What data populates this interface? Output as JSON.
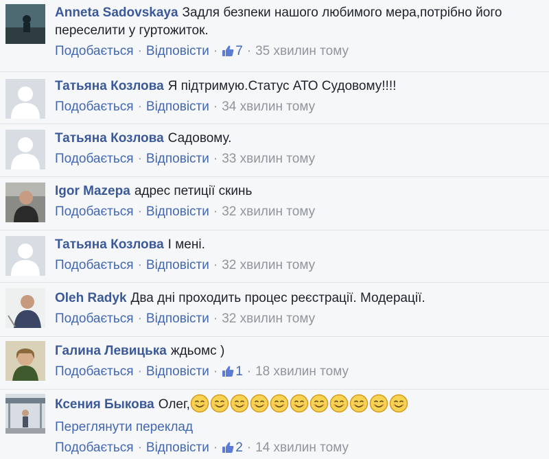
{
  "labels": {
    "like": "Подобається",
    "reply": "Відповісти",
    "dot": "·",
    "translate": "Переглянути переклад"
  },
  "colors": {
    "name": "#3b5998",
    "link": "#4267b2",
    "meta": "#90949c",
    "border": "#e1e2e6",
    "background": "#f6f7f9"
  },
  "comments": [
    {
      "name": "Anneta Sadovskaya",
      "text": "Задля безпеки нашого любимого мера,потрібно його переселити у гуртожиток.",
      "likes": "7",
      "time": "35 хвилин тому",
      "avatar": "photo"
    },
    {
      "name": "Татьяна Козлова",
      "text": "Я підтримую.Статус АТО Судовому!!!!",
      "likes": null,
      "time": "34 хвилин тому",
      "avatar": "silhouette"
    },
    {
      "name": "Татьяна Козлова",
      "text": "Садовому.",
      "likes": null,
      "time": "33 хвилин тому",
      "avatar": "silhouette"
    },
    {
      "name": "Igor Mazepa",
      "text": "адрес петиції скинь",
      "likes": null,
      "time": "32 хвилин тому",
      "avatar": "photo"
    },
    {
      "name": "Татьяна Козлова",
      "text": "І мені.",
      "likes": null,
      "time": "32 хвилин тому",
      "avatar": "silhouette"
    },
    {
      "name": "Oleh Radyk",
      "text": "Два дні проходить процес реєстрації. Модерації.",
      "likes": null,
      "time": "32 хвилин тому",
      "avatar": "photo"
    },
    {
      "name": "Галина Левицька",
      "text": "ждьомс )",
      "likes": "1",
      "time": "18 хвилин тому",
      "avatar": "photo"
    },
    {
      "name": "Ксения Быкова",
      "text": "Олег,",
      "emoji": "smiling-face",
      "emoji_count": 11,
      "likes": "2",
      "time": "14 хвилин тому",
      "avatar": "photo",
      "translate": true
    }
  ]
}
